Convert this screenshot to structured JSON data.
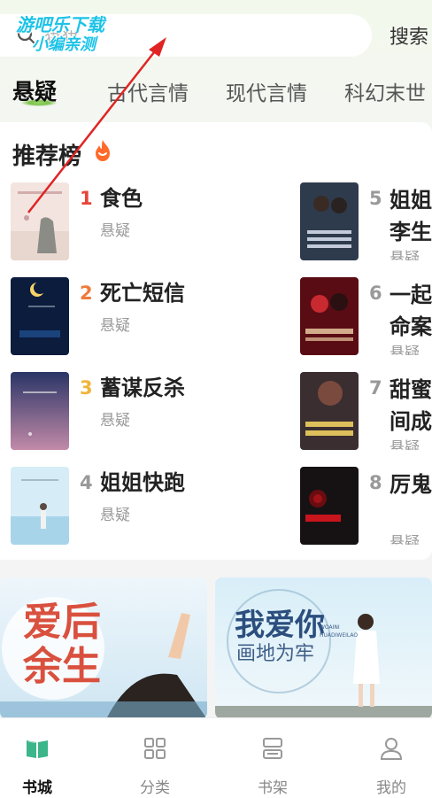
{
  "watermark": {
    "line1": "游吧乐下载",
    "line2": "小编亲测"
  },
  "search": {
    "placeholder": "猫猫",
    "button_label": "搜索"
  },
  "tabs": [
    {
      "label": "悬疑",
      "active": true
    },
    {
      "label": "古代言情",
      "active": false
    },
    {
      "label": "现代言情",
      "active": false
    },
    {
      "label": "科幻末世",
      "active": false
    }
  ],
  "ranking": {
    "title": "推荐榜",
    "books": [
      {
        "rank": "1",
        "name": "食色",
        "genre": "悬疑",
        "rank_color": "#e8443a"
      },
      {
        "rank": "2",
        "name": "死亡短信",
        "genre": "悬疑",
        "rank_color": "#f07a3a"
      },
      {
        "rank": "3",
        "name": "蓄谋反杀",
        "genre": "悬疑",
        "rank_color": "#f0b43a"
      },
      {
        "rank": "4",
        "name": "姐姐快跑",
        "genre": "悬疑",
        "rank_color": "#999999"
      },
      {
        "rank": "5",
        "name": "姐姐李生",
        "genre": "悬疑",
        "rank_color": "#999999"
      },
      {
        "rank": "6",
        "name": "一起命案",
        "genre": "悬疑",
        "rank_color": "#999999"
      },
      {
        "rank": "7",
        "name": "甜蜜间成",
        "genre": "悬疑",
        "rank_color": "#999999"
      },
      {
        "rank": "8",
        "name": "厉鬼",
        "genre": "悬疑",
        "rank_color": "#999999"
      }
    ]
  },
  "banners": [
    {
      "title": "爱后余生"
    },
    {
      "title": "我爱你",
      "subtitle": "画地为牢",
      "pinyin": "WOAINI HUADIWEILAO"
    }
  ],
  "bottom_nav": [
    {
      "label": "书城",
      "icon": "book-open-icon",
      "active": true
    },
    {
      "label": "分类",
      "icon": "grid-icon",
      "active": false
    },
    {
      "label": "书架",
      "icon": "bookshelf-icon",
      "active": false
    },
    {
      "label": "我的",
      "icon": "user-icon",
      "active": false
    }
  ],
  "colors": {
    "accent": "#3bb58a",
    "tab_underline": "#7bc24a",
    "annotation_arrow": "#e02424"
  }
}
